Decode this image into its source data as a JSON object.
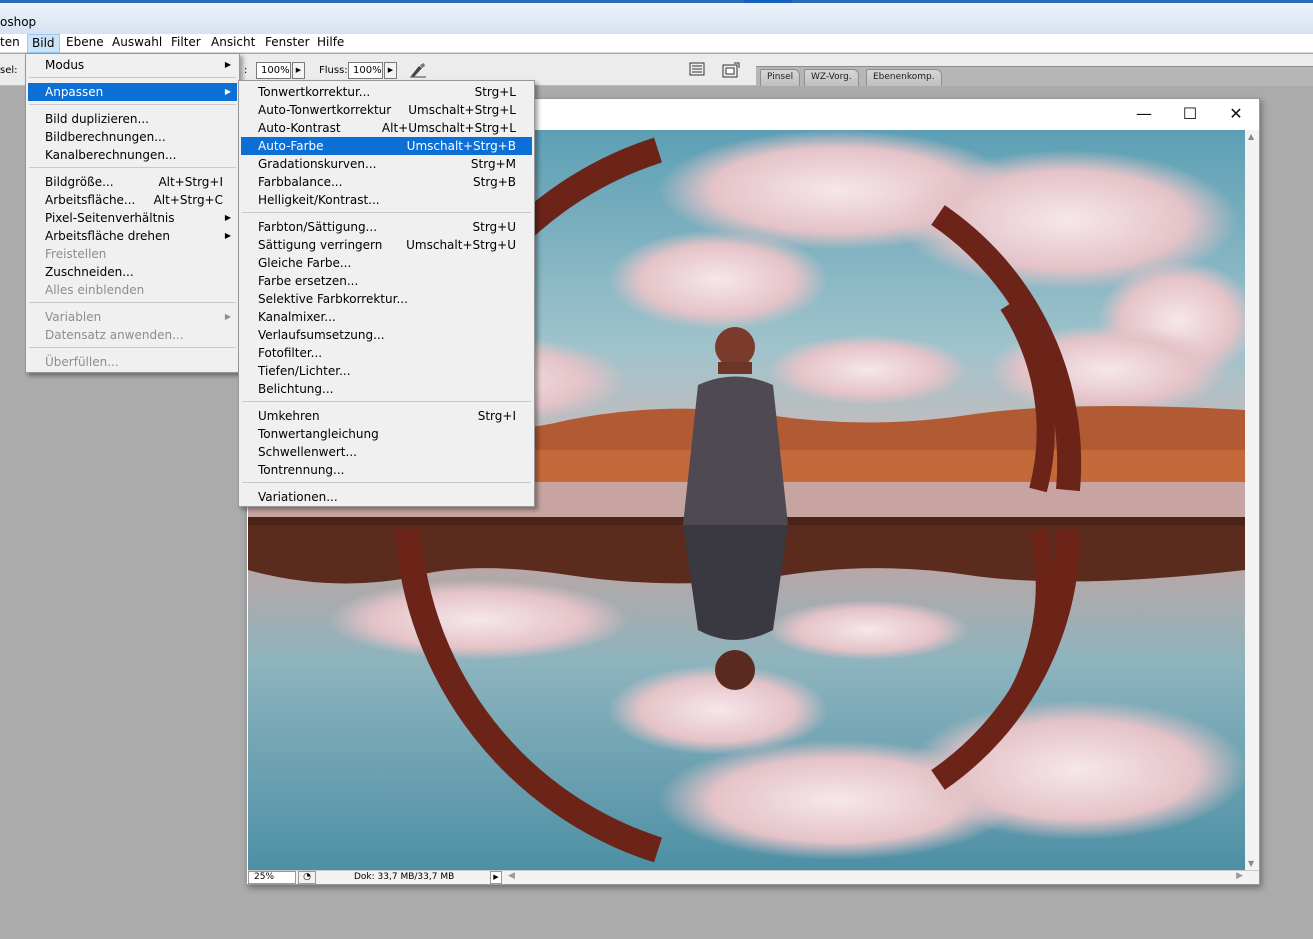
{
  "app": {
    "title": "oshop"
  },
  "menubar": {
    "items": [
      {
        "label": "ten"
      },
      {
        "label": "Bild"
      },
      {
        "label": "Ebene"
      },
      {
        "label": "Auswahl"
      },
      {
        "label": "Filter"
      },
      {
        "label": "Ansicht"
      },
      {
        "label": "Fenster"
      },
      {
        "label": "Hilfe"
      }
    ]
  },
  "options": {
    "left_label": "sel:",
    "opacity_label": ":",
    "opacity_value": "100%",
    "flow_label": "Fluss:",
    "flow_value": "100%"
  },
  "palette_well": {
    "tabs": [
      "Pinsel",
      "WZ-Vorg.",
      "Ebenenkomp."
    ]
  },
  "document": {
    "zoom": "25%",
    "doc_info": "Dok: 33,7 MB/33,7 MB",
    "window_controls": {
      "minimize": "—",
      "maximize": "☐",
      "close": "✕"
    }
  },
  "bild_menu": {
    "items": [
      {
        "label": "Modus",
        "submenu": true
      },
      {
        "label": "Anpassen",
        "submenu": true,
        "highlighted": true
      },
      {
        "label": "Bild duplizieren..."
      },
      {
        "label": "Bildberechnungen..."
      },
      {
        "label": "Kanalberechnungen..."
      },
      {
        "label": "Bildgröße...",
        "shortcut": "Alt+Strg+I"
      },
      {
        "label": "Arbeitsfläche...",
        "shortcut": "Alt+Strg+C"
      },
      {
        "label": "Pixel-Seitenverhältnis",
        "submenu": true
      },
      {
        "label": "Arbeitsfläche drehen",
        "submenu": true
      },
      {
        "label": "Freistellen",
        "disabled": true
      },
      {
        "label": "Zuschneiden..."
      },
      {
        "label": "Alles einblenden",
        "disabled": true
      },
      {
        "label": "Variablen",
        "submenu": true,
        "disabled": true
      },
      {
        "label": "Datensatz anwenden...",
        "disabled": true
      },
      {
        "label": "Überfüllen...",
        "disabled": true
      }
    ]
  },
  "anpassen_menu": {
    "items": [
      {
        "label": "Tonwertkorrektur...",
        "shortcut": "Strg+L"
      },
      {
        "label": "Auto-Tonwertkorrektur",
        "shortcut": "Umschalt+Strg+L"
      },
      {
        "label": "Auto-Kontrast",
        "shortcut": "Alt+Umschalt+Strg+L"
      },
      {
        "label": "Auto-Farbe",
        "shortcut": "Umschalt+Strg+B",
        "highlighted": true
      },
      {
        "label": "Gradationskurven...",
        "shortcut": "Strg+M"
      },
      {
        "label": "Farbbalance...",
        "shortcut": "Strg+B"
      },
      {
        "label": "Helligkeit/Kontrast..."
      },
      {
        "label": "Farbton/Sättigung...",
        "shortcut": "Strg+U"
      },
      {
        "label": "Sättigung verringern",
        "shortcut": "Umschalt+Strg+U"
      },
      {
        "label": "Gleiche Farbe..."
      },
      {
        "label": "Farbe ersetzen..."
      },
      {
        "label": "Selektive Farbkorrektur..."
      },
      {
        "label": "Kanalmixer..."
      },
      {
        "label": "Verlaufsumsetzung..."
      },
      {
        "label": "Fotofilter..."
      },
      {
        "label": "Tiefen/Lichter..."
      },
      {
        "label": "Belichtung..."
      },
      {
        "label": "Umkehren",
        "shortcut": "Strg+I"
      },
      {
        "label": "Tonwertangleichung"
      },
      {
        "label": "Schwellenwert..."
      },
      {
        "label": "Tontrennung..."
      },
      {
        "label": "Variationen..."
      }
    ]
  },
  "colors": {
    "menu_highlight": "#0b6fd5",
    "menubar_active": "#cce4f7",
    "titlebar_accent": "#2b6cb7"
  }
}
